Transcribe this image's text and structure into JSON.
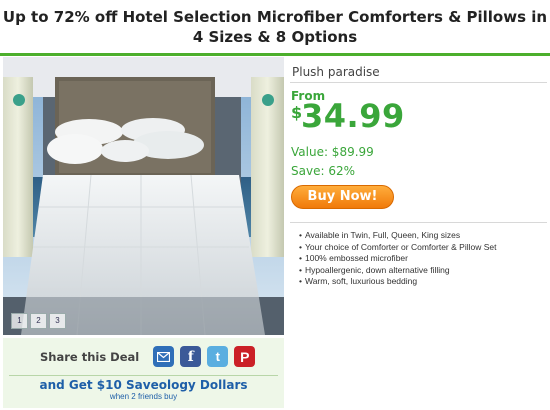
{
  "deal": {
    "title": "Up to 72% off Hotel Selection Microfiber Comforters & Pillows in 4 Sizes & 8 Options",
    "subtitle": "Plush paradise",
    "from_label": "From",
    "currency": "$",
    "price": "34.99",
    "value_text": "Value: $89.99",
    "save_text": "Save: 62%",
    "buy_label": "Buy Now!",
    "features": [
      "Available in Twin, Full, Queen, King sizes",
      "Your choice of Comforter or Comforter & Pillow Set",
      "100% embossed microfiber",
      "Hypoallergenic, down alternative filling",
      "Warm, soft, luxurious bedding"
    ]
  },
  "gallery": {
    "thumbs": [
      "1",
      "2",
      "3"
    ]
  },
  "share": {
    "label": "Share this Deal",
    "icons": [
      "mail-icon",
      "facebook-icon",
      "twitter-icon",
      "pinterest-icon"
    ],
    "cta": "and Get $10 Saveology Dollars",
    "sub": "when 2 friends buy"
  },
  "colors": {
    "accent_green": "#3aa63a",
    "buy_orange": "#f07a0a",
    "link_blue": "#1e5fa8"
  }
}
